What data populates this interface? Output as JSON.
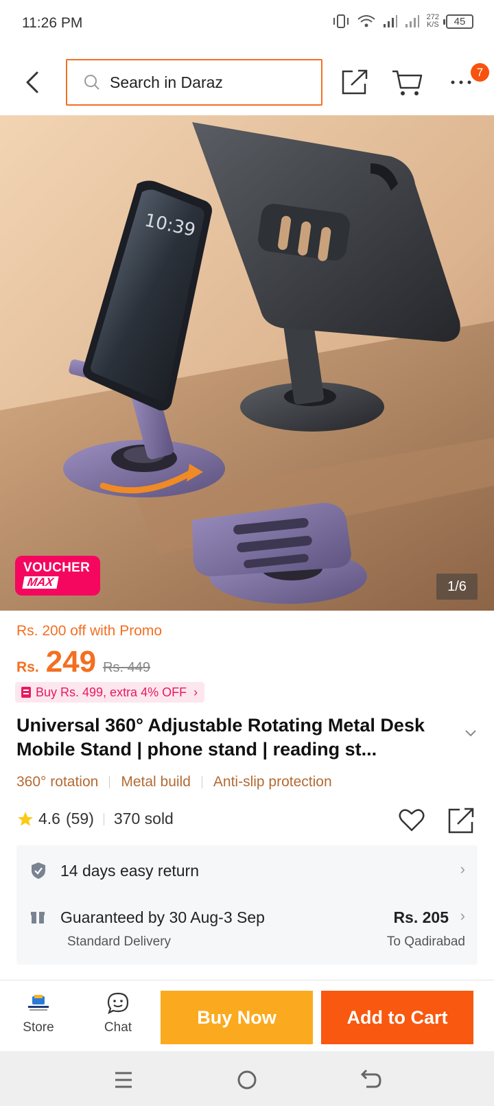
{
  "status_bar": {
    "time": "11:26 PM",
    "net_speed_value": "272",
    "net_speed_unit": "K/S",
    "battery": "45"
  },
  "header": {
    "search_placeholder": "Search in Daraz",
    "cart_count": "7"
  },
  "gallery": {
    "voucher_line1": "VOUCHER",
    "voucher_line2": "MAX",
    "image_counter": "1/6",
    "phone_clock": "10:39"
  },
  "price": {
    "promo": "Rs. 200 off with Promo",
    "currency": "Rs.",
    "current": "249",
    "original": "Rs. 449",
    "extra_offer": "Buy Rs. 499, extra 4% OFF"
  },
  "product": {
    "title": "Universal 360° Adjustable Rotating Metal Desk Mobile Stand | phone stand | reading st...",
    "features": [
      "360° rotation",
      "Metal build",
      "Anti-slip protection"
    ],
    "rating": "4.6",
    "reviews": "(59)",
    "sold": "370 sold"
  },
  "services": {
    "return_text": "14 days easy return",
    "delivery_text": "Guaranteed by 30 Aug-3 Sep",
    "delivery_type": "Standard Delivery",
    "delivery_fee": "Rs. 205",
    "delivery_location": "To Qadirabad"
  },
  "bottom_bar": {
    "store_label": "Store",
    "chat_label": "Chat",
    "buy_now": "Buy Now",
    "add_to_cart": "Add to Cart"
  },
  "colors": {
    "brand_orange": "#f36f21",
    "buy_now": "#fbaa1f",
    "add_to_cart": "#f8580f",
    "voucher_pink": "#f5075f",
    "feature_brown": "#b36a32"
  }
}
